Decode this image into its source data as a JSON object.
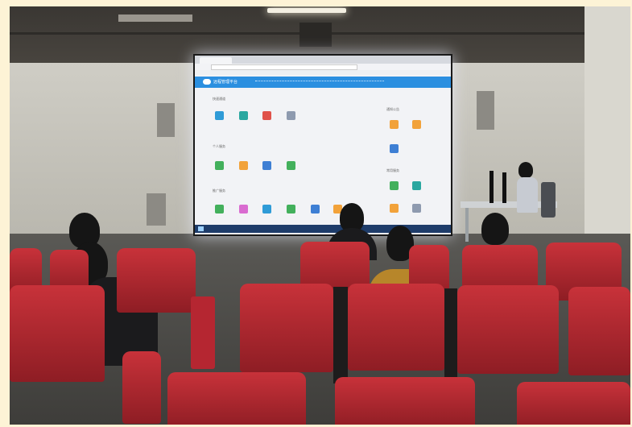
{
  "scene": {
    "description_icons": [
      "ceiling-light",
      "projection-screen",
      "speaker",
      "desk",
      "monitor",
      "office-chair",
      "auditorium-seat"
    ]
  },
  "screen": {
    "app_title": "远程管理平台",
    "sections": {
      "a": {
        "heading": "快速通道"
      },
      "b": {
        "heading": "个人服务"
      },
      "c": {
        "heading": "推广服务"
      },
      "right_a": {
        "heading": "通知公告"
      },
      "right_b": {
        "heading": "常用服务"
      }
    }
  },
  "colors": {
    "screen_header": "#2b8fe0",
    "seat_red": "#b52631",
    "wall": "#c9c7bf"
  }
}
